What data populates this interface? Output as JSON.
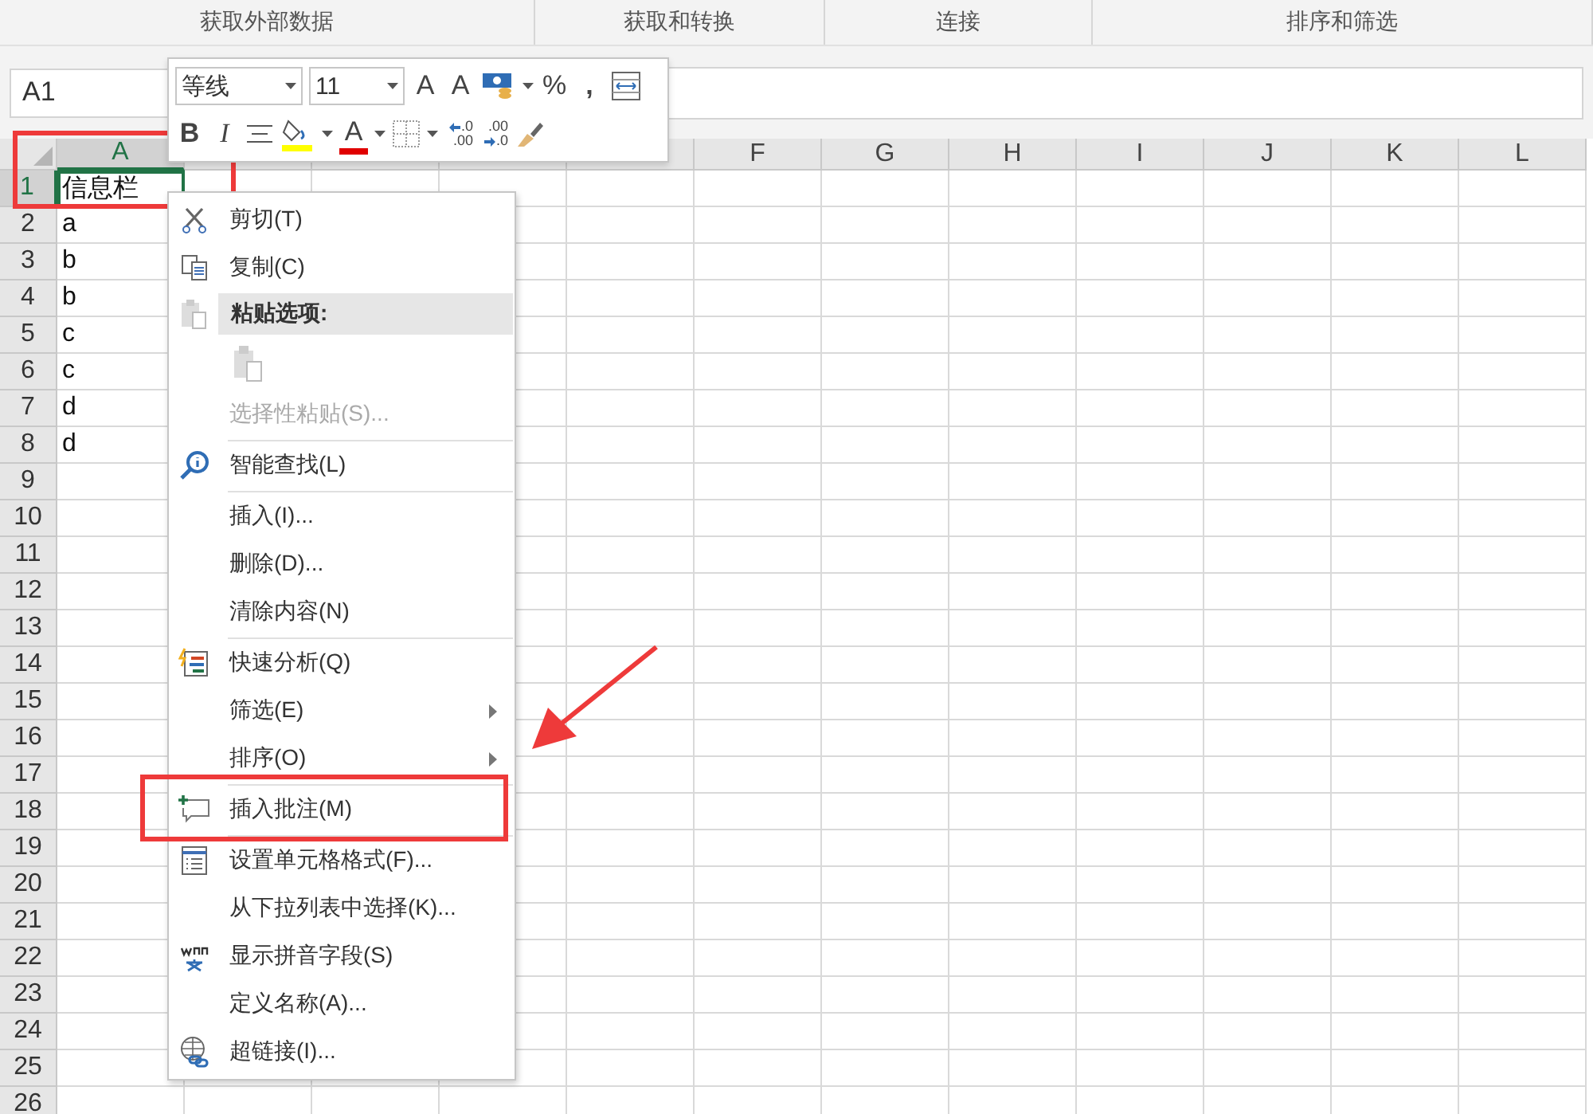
{
  "ribbon_groups": [
    "获取外部数据",
    "获取和转换",
    "连接",
    "排序和筛选"
  ],
  "name_box": {
    "value": "A1"
  },
  "mini_toolbar": {
    "font": "等线",
    "size": "11",
    "grow_font": "A",
    "shrink_font": "A",
    "percent": "%",
    "comma": ",",
    "bold": "B",
    "italic": "I",
    "font_color": "A",
    "increase_decimal": [
      ".0",
      ".00"
    ],
    "decrease_decimal": [
      ".00",
      ".0"
    ]
  },
  "columns": [
    {
      "label": "A",
      "selected": true
    },
    {},
    {},
    {},
    {},
    {
      "label": "F",
      "selected": false
    },
    {
      "label": "G",
      "selected": false
    },
    {
      "label": "H",
      "selected": false
    },
    {
      "label": "I",
      "selected": false
    },
    {
      "label": "J",
      "selected": false
    },
    {
      "label": "K",
      "selected": false
    },
    {
      "label": "L",
      "selected": false
    }
  ],
  "rows": [
    {
      "label": "1",
      "selected": true,
      "cells": [
        "信息栏"
      ]
    },
    {
      "label": "2",
      "selected": false,
      "cells": [
        "a"
      ]
    },
    {
      "label": "3",
      "selected": false,
      "cells": [
        "b"
      ]
    },
    {
      "label": "4",
      "selected": false,
      "cells": [
        "b"
      ]
    },
    {
      "label": "5",
      "selected": false,
      "cells": [
        "c"
      ]
    },
    {
      "label": "6",
      "selected": false,
      "cells": [
        "c"
      ]
    },
    {
      "label": "7",
      "selected": false,
      "cells": [
        "d"
      ]
    },
    {
      "label": "8",
      "selected": false,
      "cells": [
        "d"
      ]
    },
    {
      "label": "9",
      "selected": false,
      "cells": []
    },
    {
      "label": "10",
      "selected": false,
      "cells": []
    },
    {
      "label": "11",
      "selected": false,
      "cells": []
    },
    {
      "label": "12",
      "selected": false,
      "cells": []
    },
    {
      "label": "13",
      "selected": false,
      "cells": []
    },
    {
      "label": "14",
      "selected": false,
      "cells": []
    },
    {
      "label": "15",
      "selected": false,
      "cells": []
    },
    {
      "label": "16",
      "selected": false,
      "cells": []
    },
    {
      "label": "17",
      "selected": false,
      "cells": []
    },
    {
      "label": "18",
      "selected": false,
      "cells": []
    },
    {
      "label": "19",
      "selected": false,
      "cells": []
    },
    {
      "label": "20",
      "selected": false,
      "cells": []
    },
    {
      "label": "21",
      "selected": false,
      "cells": []
    },
    {
      "label": "22",
      "selected": false,
      "cells": []
    },
    {
      "label": "23",
      "selected": false,
      "cells": []
    },
    {
      "label": "24",
      "selected": false,
      "cells": []
    },
    {
      "label": "25",
      "selected": false,
      "cells": []
    },
    {
      "label": "26",
      "selected": false,
      "cells": []
    }
  ],
  "context_menu": [
    {
      "kind": "item",
      "label": "剪切(T)",
      "disabled": false,
      "submenu": false
    },
    {
      "kind": "item",
      "label": "复制(C)",
      "disabled": false,
      "submenu": false
    },
    {
      "kind": "header",
      "label": "粘贴选项:"
    },
    {
      "kind": "paste-options"
    },
    {
      "kind": "item",
      "label": "选择性粘贴(S)...",
      "disabled": true,
      "submenu": false
    },
    {
      "kind": "separator"
    },
    {
      "kind": "item",
      "label": "智能查找(L)",
      "disabled": false,
      "submenu": false
    },
    {
      "kind": "separator"
    },
    {
      "kind": "item",
      "label": "插入(I)...",
      "disabled": false,
      "submenu": false
    },
    {
      "kind": "item",
      "label": "删除(D)...",
      "disabled": false,
      "submenu": false
    },
    {
      "kind": "item",
      "label": "清除内容(N)",
      "disabled": false,
      "submenu": false
    },
    {
      "kind": "separator"
    },
    {
      "kind": "item",
      "label": "快速分析(Q)",
      "disabled": false,
      "submenu": false
    },
    {
      "kind": "item",
      "label": "筛选(E)",
      "disabled": false,
      "submenu": true
    },
    {
      "kind": "item",
      "label": "排序(O)",
      "disabled": false,
      "submenu": true
    },
    {
      "kind": "separator"
    },
    {
      "kind": "item",
      "label": "插入批注(M)",
      "disabled": false,
      "submenu": false
    },
    {
      "kind": "separator"
    },
    {
      "kind": "item",
      "label": "设置单元格格式(F)...",
      "disabled": false,
      "submenu": false
    },
    {
      "kind": "item",
      "label": "从下拉列表中选择(K)...",
      "disabled": false,
      "submenu": false
    },
    {
      "kind": "item",
      "label": "显示拼音字段(S)",
      "disabled": false,
      "submenu": false
    },
    {
      "kind": "item",
      "label": "定义名称(A)...",
      "disabled": false,
      "submenu": false
    },
    {
      "kind": "item",
      "label": "超链接(I)...",
      "disabled": false,
      "submenu": false
    }
  ],
  "annotations": [
    {
      "kind": "box"
    },
    {
      "kind": "box"
    },
    {
      "kind": "arrow"
    }
  ]
}
